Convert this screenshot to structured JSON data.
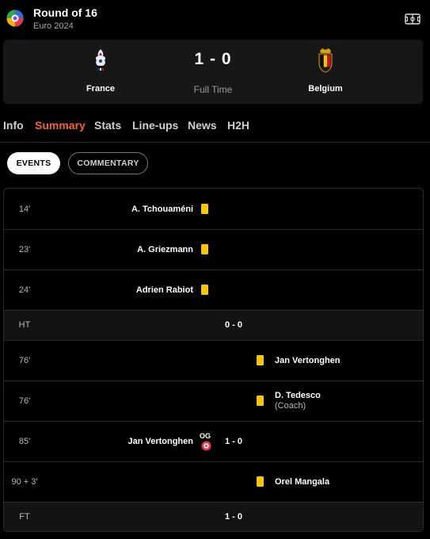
{
  "header": {
    "round": "Round of 16",
    "competition": "Euro 2024",
    "competition_logo_icon": "euro-2024-logo-icon",
    "pitch_icon": "pitch-view-icon"
  },
  "match": {
    "home_team": "France",
    "away_team": "Belgium",
    "score": "1 - 0",
    "status": "Full Time",
    "home_crest": "france-crest-icon",
    "away_crest": "belgium-crest-icon"
  },
  "tabs": [
    {
      "label": "Info",
      "active": false
    },
    {
      "label": "Summary",
      "active": true
    },
    {
      "label": "Stats",
      "active": false
    },
    {
      "label": "Line-ups",
      "active": false
    },
    {
      "label": "News",
      "active": false
    },
    {
      "label": "H2H",
      "active": false
    }
  ],
  "subtabs": {
    "events": "EVENTS",
    "commentary": "COMMENTARY"
  },
  "events": [
    {
      "minute": "14'",
      "home_player": "A. Tchouaméni",
      "type": "yellow-card",
      "side": "home"
    },
    {
      "minute": "23'",
      "home_player": "A. Griezmann",
      "type": "yellow-card",
      "side": "home"
    },
    {
      "minute": "24'",
      "home_player": "Adrien Rabiot",
      "type": "yellow-card",
      "side": "home"
    },
    {
      "minute": "HT",
      "score": "0 - 0",
      "type": "break"
    },
    {
      "minute": "76'",
      "away_player": "Jan Vertonghen",
      "type": "yellow-card",
      "side": "away"
    },
    {
      "minute": "76'",
      "away_player": "D. Tedesco",
      "away_sub": "(Coach)",
      "type": "yellow-card",
      "side": "away"
    },
    {
      "minute": "85'",
      "home_player": "Jan Vertonghen",
      "og_label": "OG",
      "score": "1 - 0",
      "type": "own-goal",
      "side": "home"
    },
    {
      "minute": "90 + 3'",
      "away_player": "Orel Mangala",
      "type": "yellow-card",
      "side": "away"
    },
    {
      "minute": "FT",
      "score": "1 - 0",
      "type": "break"
    }
  ],
  "colors": {
    "accent": "#f2642a",
    "yellow_card": "#f7c60b",
    "ball_red": "#e63946"
  }
}
